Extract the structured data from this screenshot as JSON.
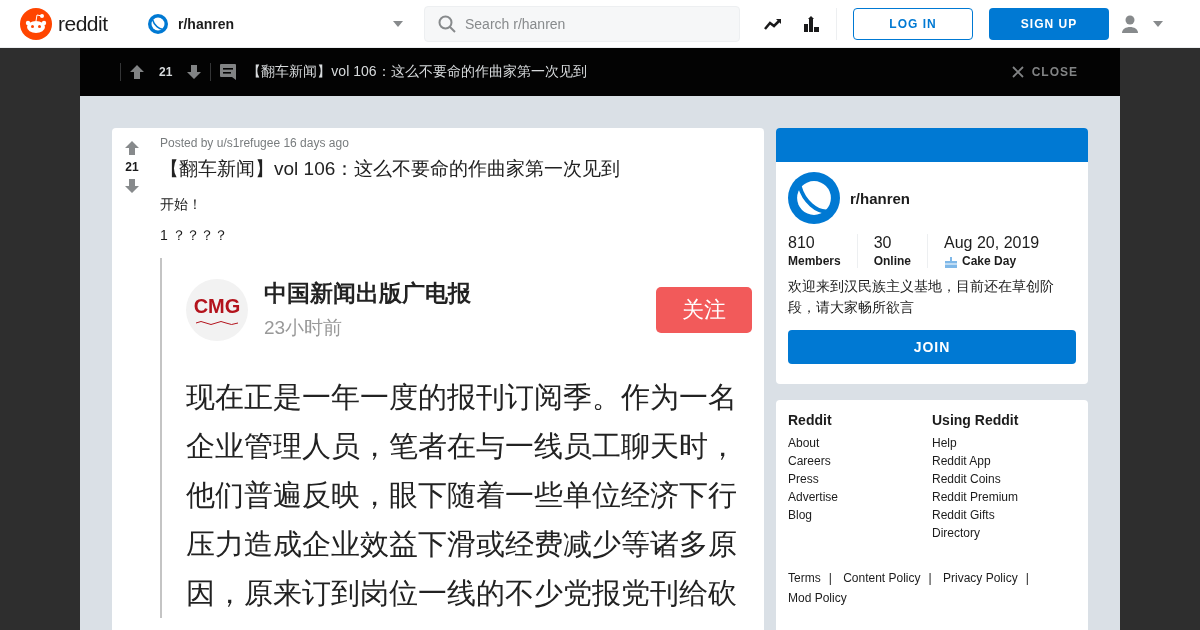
{
  "header": {
    "logo_text": "reddit",
    "community": "r/hanren",
    "search": {
      "placeholder": "Search r/hanren"
    },
    "login": "LOG IN",
    "signup": "SIGN UP"
  },
  "post_bar": {
    "score": "21",
    "title": "【翻车新闻】vol 106：这么不要命的作曲家第一次见到",
    "close": "CLOSE"
  },
  "post": {
    "score": "21",
    "meta": "Posted by u/s1refugee 16 days ago",
    "title": "【翻车新闻】vol 106：这么不要命的作曲家第一次见到",
    "body": [
      "开始！",
      "1 ？？？？"
    ],
    "embedded": {
      "logo_text": "CMG",
      "account": "中国新闻出版广电报",
      "time": "23小时前",
      "follow": "关注",
      "lines": [
        "现在正是一年一度的报刊订阅季。作为一名",
        "企业管理人员，笔者在与一线员工聊天时，",
        "他们普遍反映，眼下随着一些单位经济下行",
        "压力造成企业效益下滑或经费减少等诸多原",
        "因，原来订到岗位一线的不少党报党刊给砍"
      ]
    }
  },
  "sidebar": {
    "community": "r/hanren",
    "stats": [
      {
        "value": "810",
        "label": "Members",
        "kind": "plain"
      },
      {
        "value": "30",
        "label": "Online",
        "kind": "plain"
      },
      {
        "value": "Aug 20, 2019",
        "label": "Cake Day",
        "kind": "cake"
      }
    ],
    "description": "欢迎来到汉民族主义基地，目前还在草创阶段，请大家畅所欲言",
    "join": "JOIN"
  },
  "footer": {
    "columns": [
      {
        "heading": "Reddit",
        "links": [
          "About",
          "Careers",
          "Press",
          "Advertise",
          "Blog"
        ]
      },
      {
        "heading": "Using Reddit",
        "links": [
          "Help",
          "Reddit App",
          "Reddit Coins",
          "Reddit Premium",
          "Reddit Gifts",
          "Directory"
        ]
      }
    ],
    "legal": [
      "Terms",
      "Content Policy",
      "Privacy Policy",
      "Mod Policy"
    ],
    "legal_separator": "|"
  }
}
